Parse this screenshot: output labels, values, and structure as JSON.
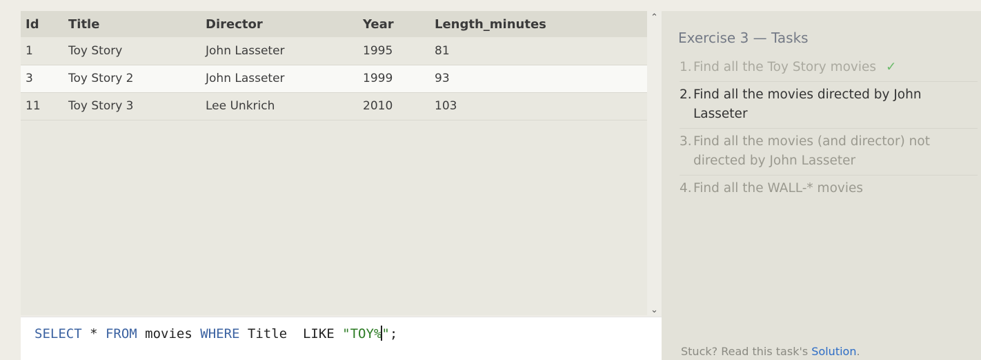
{
  "results": {
    "columns": [
      "Id",
      "Title",
      "Director",
      "Year",
      "Length_minutes"
    ],
    "rows": [
      [
        "1",
        "Toy Story",
        "John Lasseter",
        "1995",
        "81"
      ],
      [
        "3",
        "Toy Story 2",
        "John Lasseter",
        "1999",
        "93"
      ],
      [
        "11",
        "Toy Story 3",
        "Lee Unkrich",
        "2010",
        "103"
      ]
    ]
  },
  "scrollbar": {
    "up_glyph": "⌃",
    "down_glyph": "⌄"
  },
  "editor": {
    "kw_select": "SELECT",
    "star": " * ",
    "kw_from": "FROM",
    "table": " movies ",
    "kw_where": "WHERE",
    "cond": " Title  LIKE ",
    "string_before_caret": "\"TOY%",
    "string_after_caret": "\"",
    "terminator": ";"
  },
  "tasks": {
    "title": "Exercise 3 — Tasks",
    "items": [
      {
        "num": "1.",
        "text": "Find all the Toy Story movies",
        "status": "done",
        "check": "✓"
      },
      {
        "num": "2.",
        "text": "Find all the movies directed by John Lasseter",
        "status": "current"
      },
      {
        "num": "3.",
        "text": "Find all the movies (and director) not directed by John Lasseter",
        "status": "todo"
      },
      {
        "num": "4.",
        "text": "Find all the WALL-* movies",
        "status": "todo"
      }
    ],
    "stuck_prefix": "Stuck? Read this task's ",
    "solution_link": "Solution",
    "stuck_suffix": "."
  }
}
